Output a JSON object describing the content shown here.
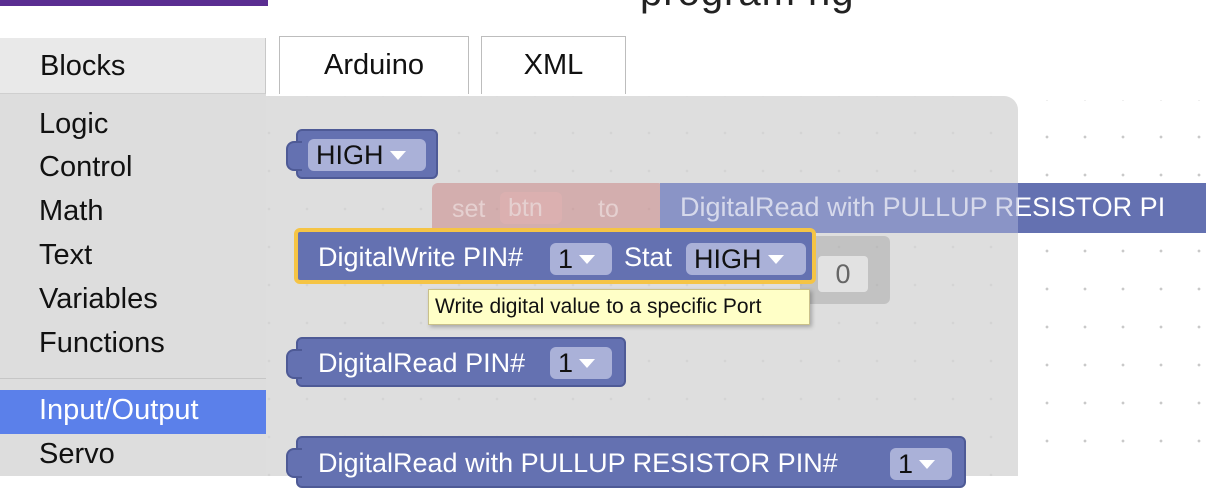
{
  "header": {
    "title_fragment": "program ng"
  },
  "toolbox": {
    "blocks_tab": "Blocks",
    "categories": [
      {
        "label": "Logic"
      },
      {
        "label": "Control"
      },
      {
        "label": "Math"
      },
      {
        "label": "Text"
      },
      {
        "label": "Variables"
      },
      {
        "label": "Functions"
      },
      {
        "label": "Input/Output"
      },
      {
        "label": "Servo"
      }
    ],
    "selected": "Input/Output"
  },
  "tabs": {
    "arduino": "Arduino",
    "xml": "XML"
  },
  "blocks": {
    "high": {
      "value": "HIGH"
    },
    "set_var": {
      "set": "set",
      "var": "btn",
      "to": "to"
    },
    "digital_read_pullup_ghost": {
      "label": "DigitalRead with PULLUP RESISTOR PI"
    },
    "digital_write": {
      "label": "DigitalWrite PIN#",
      "pin": "1",
      "stat_label": "Stat",
      "stat": "HIGH"
    },
    "ghost_zero": "0",
    "digital_read": {
      "label": "DigitalRead PIN#",
      "pin": "1"
    },
    "digital_read_pullup": {
      "label": "DigitalRead with PULLUP RESISTOR PIN#",
      "pin": "1"
    }
  },
  "tooltip": "Write digital value to a specific Port",
  "colors": {
    "io_block": "#6471b1",
    "selected_outline": "#f5c445",
    "category_selected": "#5b80ea"
  }
}
